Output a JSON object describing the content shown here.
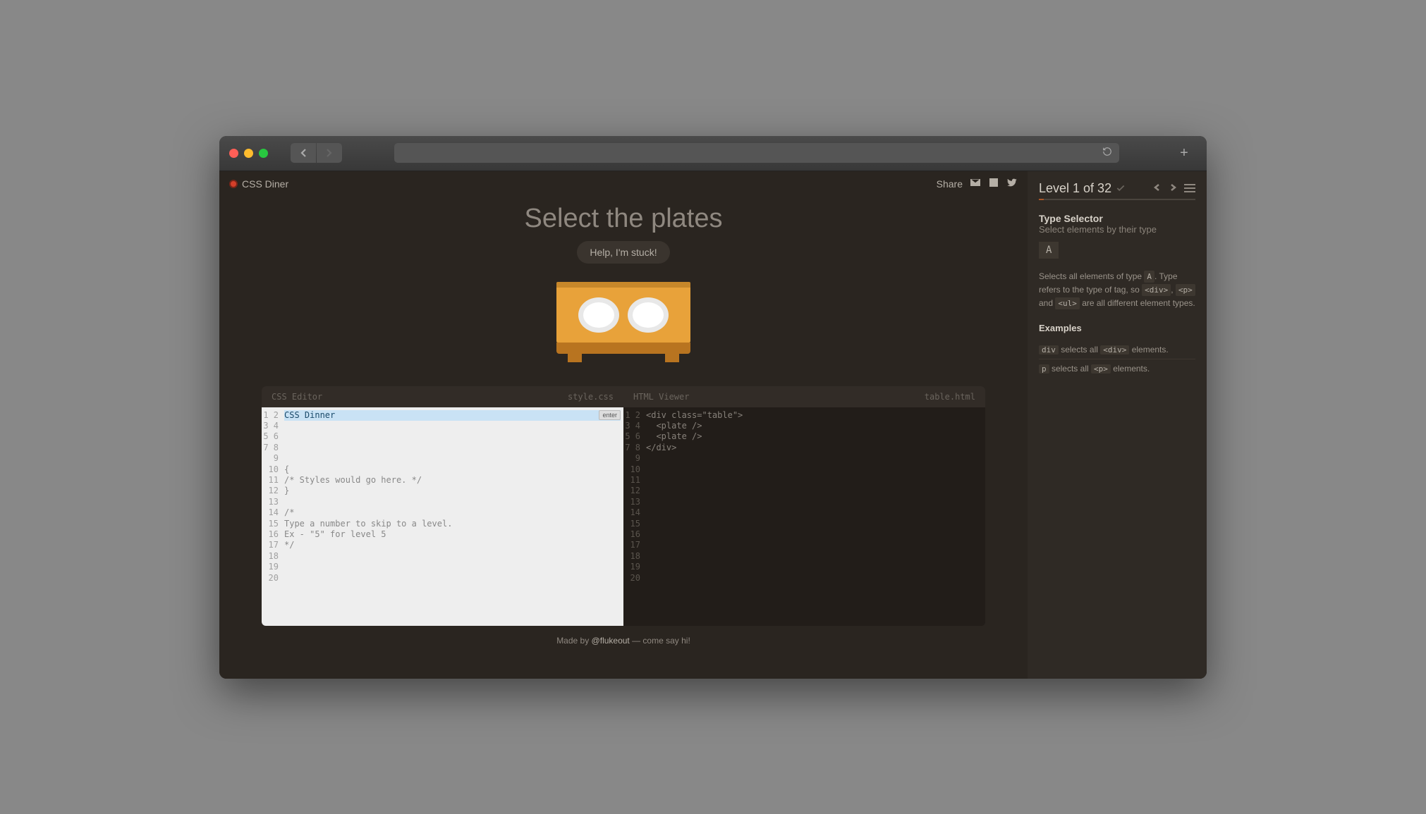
{
  "app": {
    "title": "CSS Diner",
    "share_label": "Share"
  },
  "hero": {
    "heading": "Select the plates",
    "help_button": "Help, I'm stuck!"
  },
  "editors": {
    "css": {
      "title": "CSS Editor",
      "filename": "style.css",
      "line_count": 20,
      "input_value": "CSS Dinner",
      "enter_label": "enter",
      "lines": [
        "",
        "{",
        "/* Styles would go here. */",
        "}",
        "",
        "/*",
        "Type a number to skip to a level.",
        "Ex - \"5\" for level 5",
        "*/"
      ]
    },
    "html": {
      "title": "HTML Viewer",
      "filename": "table.html",
      "line_count": 20,
      "lines": [
        "<div class=\"table\">",
        "  <plate />",
        "  <plate />",
        "</div>"
      ]
    }
  },
  "sidebar": {
    "level_label": "Level 1 of 32",
    "selector_name": "Type Selector",
    "selector_subtitle": "Select elements by their type",
    "syntax": "A",
    "help_parts": {
      "p1": "Selects all elements of type ",
      "tagA": "A",
      "p2": ". Type refers to the type of tag, so ",
      "tag_div": "<div>",
      "p3": ", ",
      "tag_p": "<p>",
      "p4": " and ",
      "tag_ul": "<ul>",
      "p5": " are all different element types."
    },
    "examples_title": "Examples",
    "examples": [
      {
        "sel": "div",
        "mid": " selects all ",
        "tag": "<div>",
        "post": " elements."
      },
      {
        "sel": "p",
        "mid": " selects all ",
        "tag": "<p>",
        "post": " elements."
      }
    ]
  },
  "footer": {
    "prefix": "Made by ",
    "author": "@flukeout",
    "suffix": " — come say hi!"
  }
}
